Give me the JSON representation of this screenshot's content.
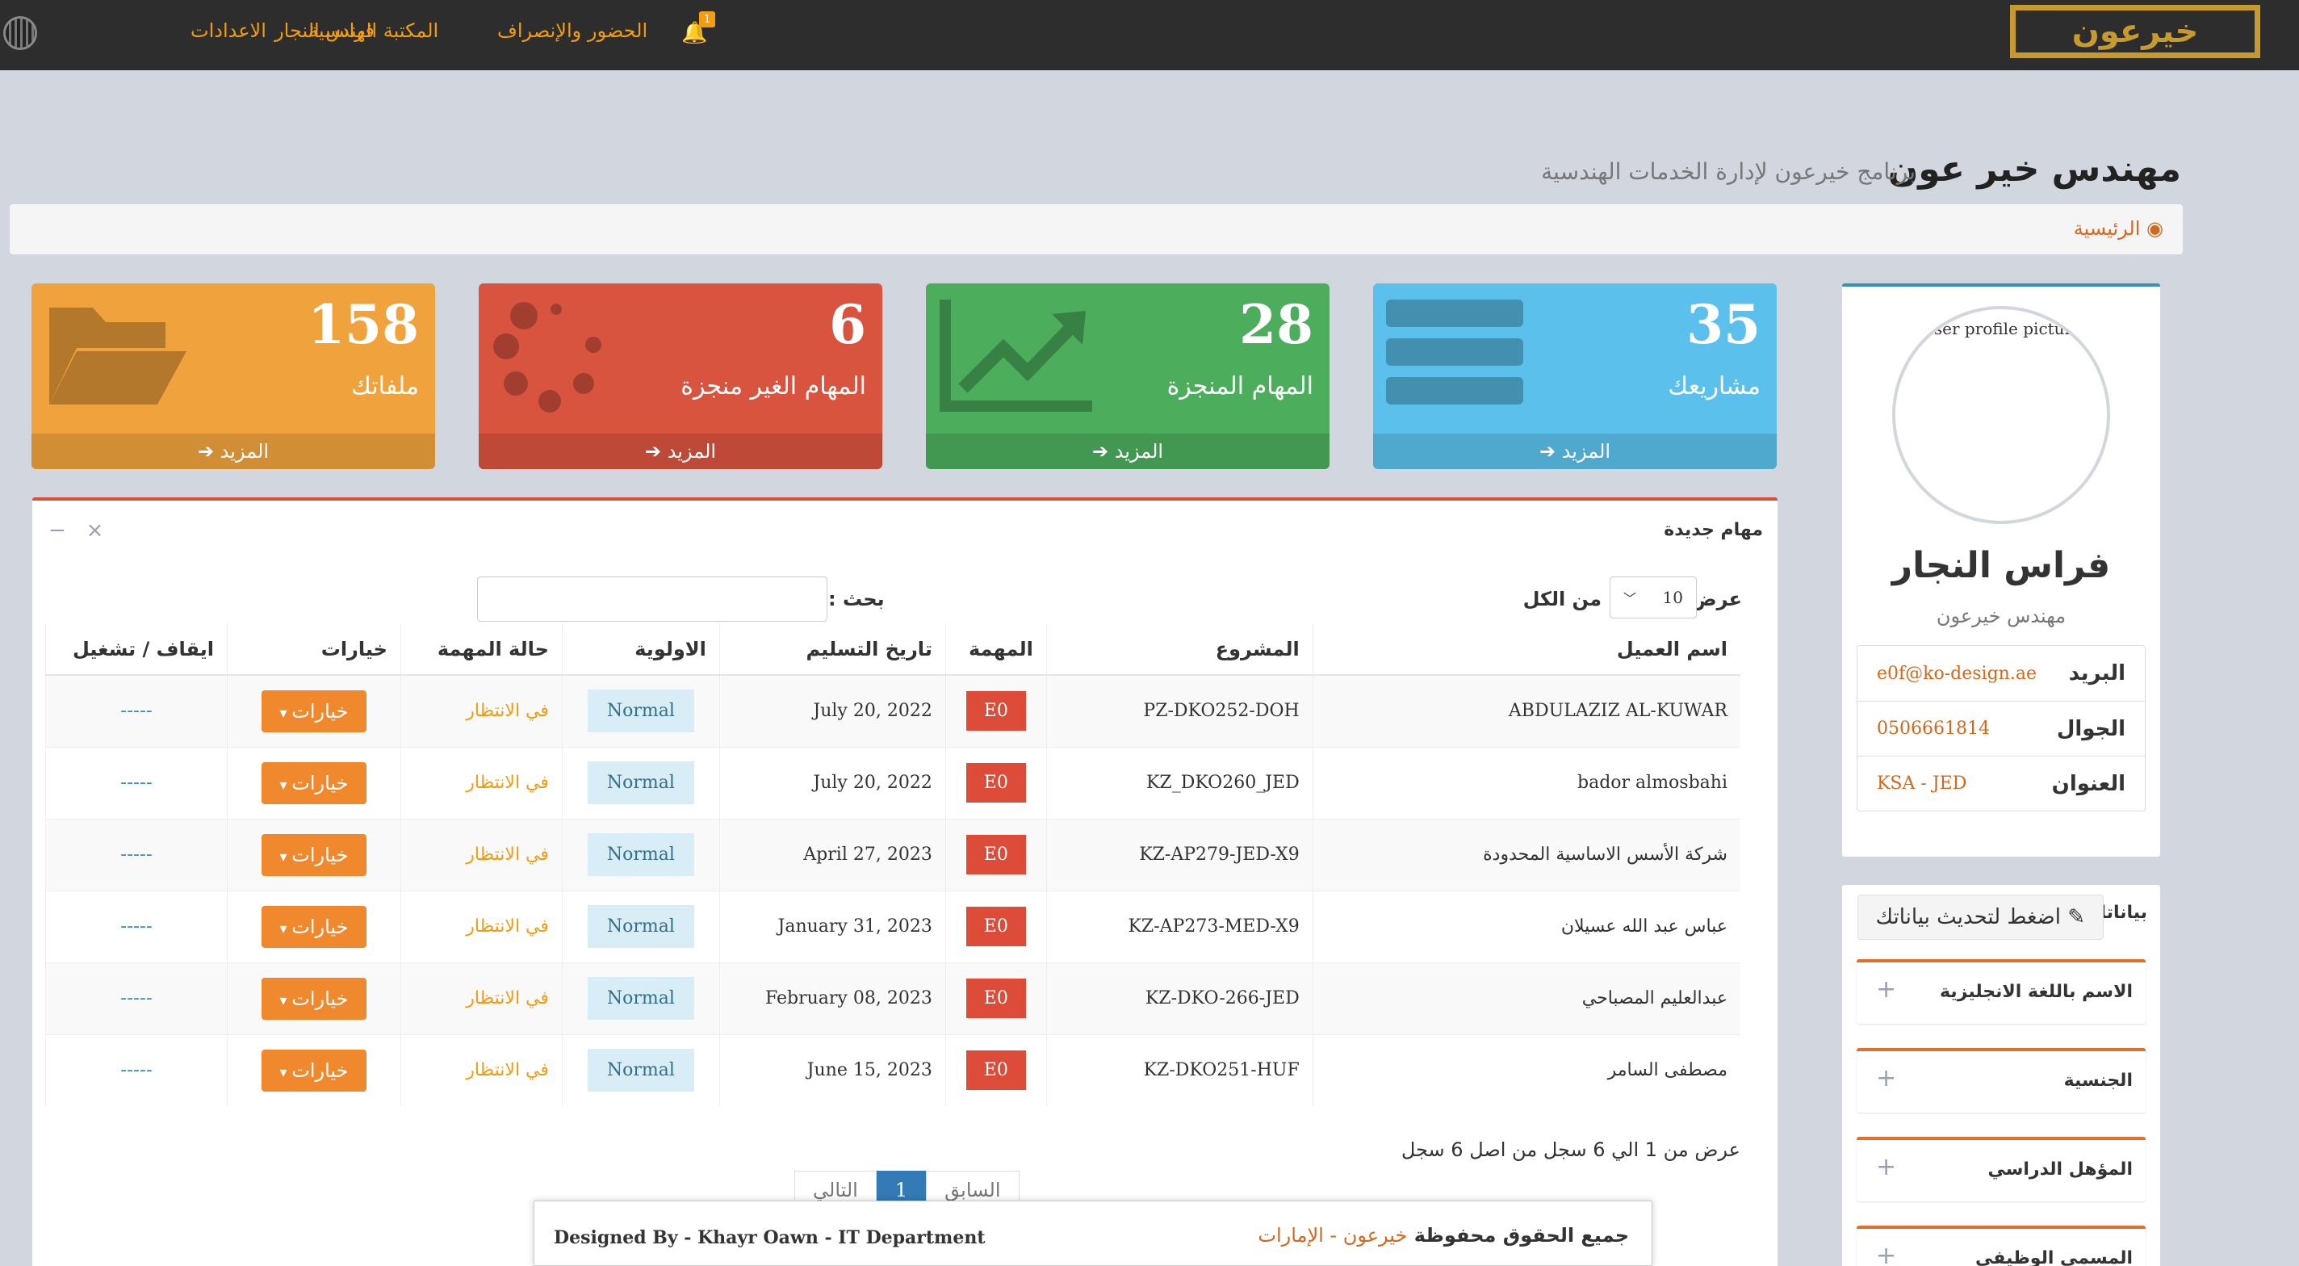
{
  "nav": {
    "logo": "خيرعون",
    "items": [
      "فراس النجار",
      "الاعدادات",
      "المكتبة الهندسية",
      "الحضور والإنصراف"
    ],
    "notifications": "1"
  },
  "header": {
    "title": "مهندس خير عون",
    "subtitle": "برنامج خيرعون لإدارة الخدمات الهندسية"
  },
  "breadcrumb": {
    "home": "الرئيسية"
  },
  "stats": [
    {
      "value": "35",
      "label": "مشاريعك",
      "more": "المزيد",
      "color": "#5bc0eb"
    },
    {
      "value": "28",
      "label": "المهام المنجزة",
      "more": "المزيد",
      "color": "#4cae5c"
    },
    {
      "value": "6",
      "label": "المهام الغير منجزة",
      "more": "المزيد",
      "color": "#d9543f"
    },
    {
      "value": "158",
      "label": "ملفاتك",
      "more": "المزيد",
      "color": "#f0a23c"
    }
  ],
  "tasks": {
    "title": "مهام جديدة",
    "show_label": "عرض",
    "page_size": "10",
    "of_all": "من الكل",
    "search_label": "بحث :",
    "columns": [
      "اسم العميل",
      "المشروع",
      "المهمة",
      "تاريخ التسليم",
      "الاولوية",
      "حالة المهمة",
      "خيارات",
      "ايقاف / تشغيل"
    ],
    "rows": [
      [
        "ABDULAZIZ AL-KUWAR",
        "PZ-DKO252-DOH",
        "E0",
        "July 20, 2022",
        "Normal",
        "في الانتظار",
        "خيارات",
        "-----"
      ],
      [
        "bador almosbahi",
        "KZ_DKO260_JED",
        "E0",
        "July 20, 2022",
        "Normal",
        "في الانتظار",
        "خيارات",
        "-----"
      ],
      [
        "شركة الأسس الاساسية المحدودة",
        "KZ-AP279-JED-X9",
        "E0",
        "April 27, 2023",
        "Normal",
        "في الانتظار",
        "خيارات",
        "-----"
      ],
      [
        "عباس عبد الله عسيلان",
        "KZ-AP273-MED-X9",
        "E0",
        "January 31, 2023",
        "Normal",
        "في الانتظار",
        "خيارات",
        "-----"
      ],
      [
        "عبدالعليم المصباحي",
        "KZ-DKO-266-JED",
        "E0",
        "February 08, 2023",
        "Normal",
        "في الانتظار",
        "خيارات",
        "-----"
      ],
      [
        "مصطفى السامر",
        "KZ-DKO251-HUF",
        "E0",
        "June 15, 2023",
        "Normal",
        "في الانتظار",
        "خيارات",
        "-----"
      ]
    ],
    "info": "عرض من 1 الي 6 سجل من اصل 6 سجل",
    "pager": {
      "prev": "السابق",
      "current": "1",
      "next": "التالي"
    }
  },
  "profile": {
    "pic_alt": "User profile picture",
    "name": "فراس النجار",
    "role": "مهندس خيرعون",
    "fields": [
      {
        "key": "البريد",
        "value": "e0f@ko-design.ae"
      },
      {
        "key": "الجوال",
        "value": "0506661814"
      },
      {
        "key": "العنوان",
        "value": "KSA - JED"
      }
    ]
  },
  "datapanel": {
    "label": "بياناتك",
    "update_button": "اضغط لتحديث بياناتك",
    "sections": [
      "الاسم باللغة الانجليزية",
      "الجنسية",
      "المؤهل الدراسي",
      "المسمى الوظيفي"
    ]
  },
  "footer": {
    "designed_by": "Designed By - Khayr Oawn - IT Department",
    "rights": "جميع الحقوق محفوظة",
    "brand": "خيرعون - الإمارات"
  }
}
